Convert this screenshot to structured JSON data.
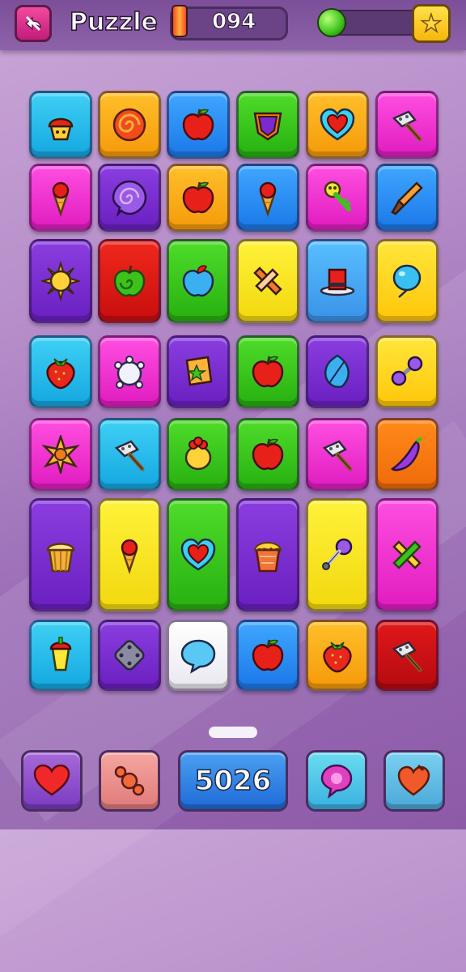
{
  "header": {
    "title": "Puzzle",
    "score": "094",
    "progress_fraction": 0.0
  },
  "board": {
    "rows": [
      [
        {
          "color": "cyan",
          "icon": "cupcake-icon"
        },
        {
          "color": "orange",
          "icon": "swirl-candy-icon"
        },
        {
          "color": "blue",
          "icon": "apple-icon"
        },
        {
          "color": "green",
          "icon": "purple-shield-icon"
        },
        {
          "color": "orange",
          "icon": "heart-icon"
        },
        {
          "color": "magenta",
          "icon": "hammer-icon"
        }
      ],
      [
        {
          "color": "magenta",
          "icon": "ice-cream-cone-icon"
        },
        {
          "color": "purple",
          "icon": "purple-swirl-icon"
        },
        {
          "color": "orange",
          "icon": "apple-icon"
        },
        {
          "color": "blue",
          "icon": "ice-cream-cone-icon"
        },
        {
          "color": "magenta",
          "icon": "key-icon"
        },
        {
          "color": "blue",
          "icon": "paintbrush-icon"
        }
      ],
      [
        {
          "color": "purple",
          "icon": "sun-icon"
        },
        {
          "color": "red",
          "icon": "green-apple-icon"
        },
        {
          "color": "green",
          "icon": "blue-apple-icon"
        },
        {
          "color": "yellow",
          "icon": "cross-candy-icon"
        },
        {
          "color": "lightblue",
          "icon": "top-hat-icon"
        },
        {
          "color": "gold",
          "icon": "balloon-icon"
        }
      ],
      [
        {
          "color": "cyan",
          "icon": "strawberry-icon"
        },
        {
          "color": "magenta",
          "icon": "white-turtle-icon"
        },
        {
          "color": "purple",
          "icon": "flag-icon"
        },
        {
          "color": "green",
          "icon": "apple-icon"
        },
        {
          "color": "purple",
          "icon": "blue-leaf-icon"
        },
        {
          "color": "gold",
          "icon": "dumbbell-icon"
        }
      ],
      [
        {
          "color": "magenta",
          "icon": "sun-star-icon"
        },
        {
          "color": "cyan",
          "icon": "hammer-icon"
        },
        {
          "color": "green",
          "icon": "lemon-icon"
        },
        {
          "color": "green",
          "icon": "apple-icon"
        },
        {
          "color": "magenta",
          "icon": "hammer-icon"
        },
        {
          "color": "deeporange",
          "icon": "chili-pepper-icon"
        }
      ],
      [
        {
          "color": "purple",
          "icon": "popcorn-icon"
        },
        {
          "color": "yellow",
          "icon": "ice-cream-cone-icon"
        },
        {
          "color": "green",
          "icon": "heart-icon"
        },
        {
          "color": "purple",
          "icon": "cake-icon"
        },
        {
          "color": "yellow",
          "icon": "microphone-icon"
        },
        {
          "color": "magenta",
          "icon": "cross-icon"
        }
      ],
      [
        {
          "color": "cyan",
          "icon": "sippy-cup-icon"
        },
        {
          "color": "purple",
          "icon": "dice-icon"
        },
        {
          "color": "white",
          "icon": "speech-bubble-icon"
        },
        {
          "color": "blue",
          "icon": "apple-icon"
        },
        {
          "color": "orange",
          "icon": "strawberry-icon"
        },
        {
          "color": "deepred",
          "icon": "hammer-icon"
        }
      ]
    ]
  },
  "footer": {
    "score": "5026",
    "buttons": [
      "heart-icon",
      "candy-icon",
      "score-display",
      "chat-bubble-icon",
      "heart-hand-icon"
    ]
  },
  "colors": {
    "topbar": "#7b4f99",
    "back_button": "#e0268a",
    "star_button": "#ffd93a"
  }
}
